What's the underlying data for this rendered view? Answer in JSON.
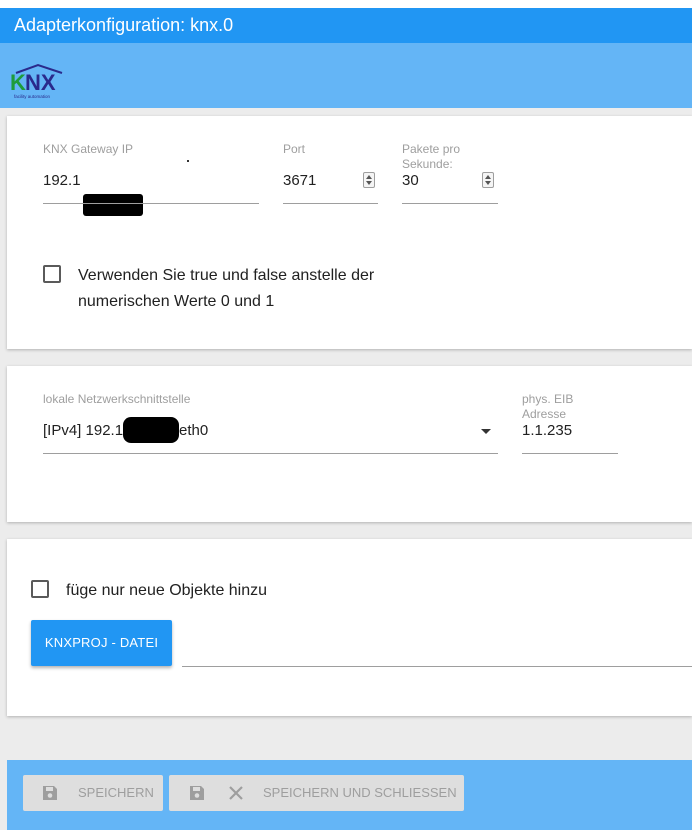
{
  "window": {
    "title": "Adapterkonfiguration: knx.0"
  },
  "logo": {
    "text": "KNX",
    "tagline": "facility automation"
  },
  "gateway": {
    "ip_label": "KNX Gateway IP",
    "ip_value": "192.1",
    "port_label": "Port",
    "port_value": "3671",
    "packets_label": "Pakete pro Sekunde:",
    "packets_value": "30"
  },
  "option_bool": {
    "label_line1": "Verwenden Sie true und false anstelle der",
    "label_line2": "numerischen Werte 0 und 1",
    "checked": false
  },
  "network": {
    "interface_label": "lokale Netzwerkschnittstelle",
    "interface_value_prefix": "[IPv4] 192.1",
    "interface_value_suffix": "eth0",
    "eib_label": "phys. EIB Adresse",
    "eib_value": "1.1.235"
  },
  "import": {
    "only_new_label": "füge nur neue Objekte hinzu",
    "only_new_checked": false,
    "file_button_label": "KNXPROJ - DATEI"
  },
  "footer": {
    "save_label": "SPEICHERN",
    "save_close_label": "SPEICHERN UND SCHLIESSEN"
  },
  "colors": {
    "primary": "#2196f3",
    "primary_light": "#64b5f6",
    "disabled": "#dedede"
  },
  "icons": {
    "save": "floppy-disk-icon",
    "close": "close-x-icon",
    "dropdown": "caret-down-icon"
  }
}
